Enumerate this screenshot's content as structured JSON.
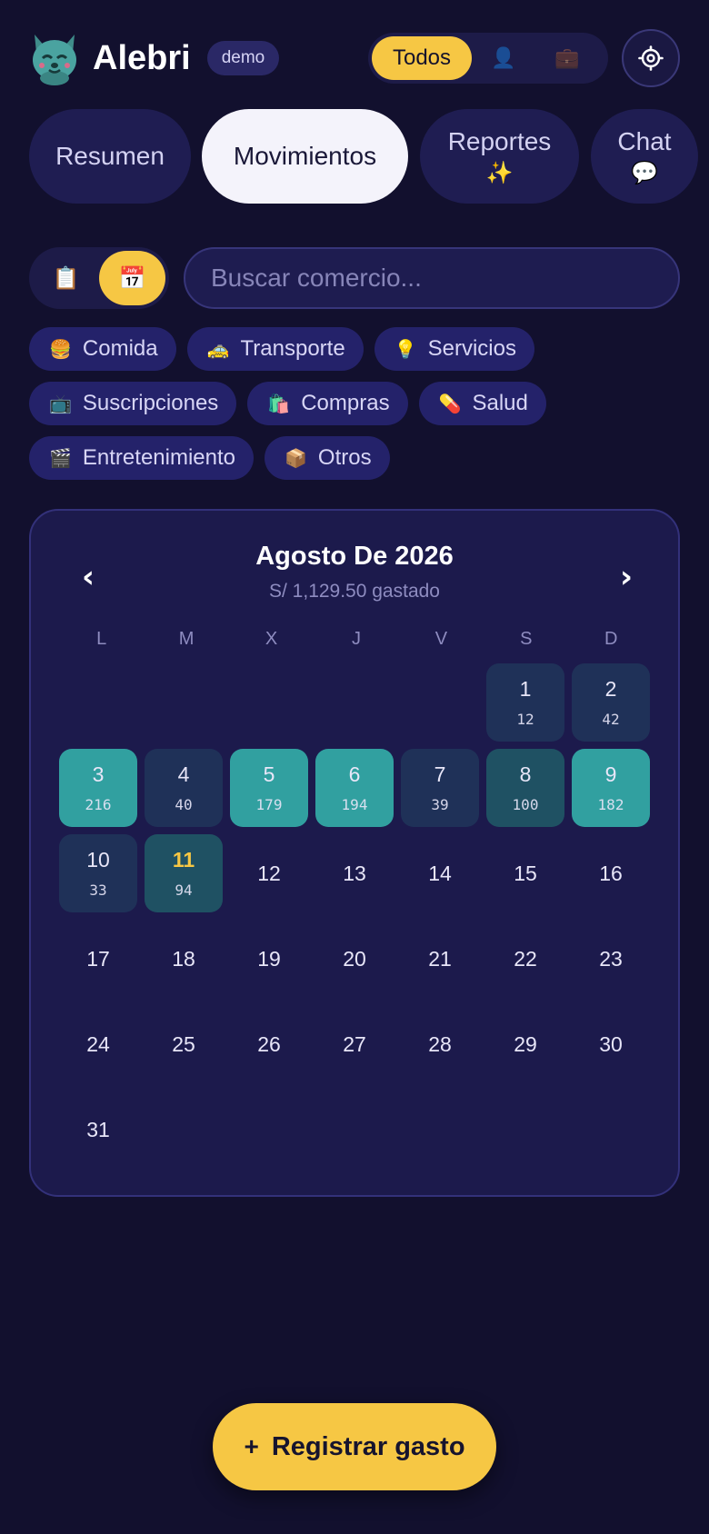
{
  "header": {
    "brand": "Alebri",
    "badge": "demo",
    "scope": [
      {
        "label": "Todos",
        "active": true
      },
      {
        "icon": "person-icon",
        "glyph": "👤",
        "active": false
      },
      {
        "icon": "briefcase-icon",
        "glyph": "💼",
        "active": false
      }
    ],
    "settings_icon": "gear-icon"
  },
  "tabs": [
    {
      "label": "Resumen",
      "emoji": "",
      "active": false
    },
    {
      "label": "Movimientos",
      "emoji": "",
      "active": true
    },
    {
      "label": "Reportes",
      "emoji": "✨",
      "active": false
    },
    {
      "label": "Chat",
      "emoji": "💬",
      "active": false
    }
  ],
  "view_toggle": [
    {
      "icon": "clipboard-icon",
      "glyph": "📋",
      "active": false
    },
    {
      "icon": "calendar-icon",
      "glyph": "📅",
      "active": true
    }
  ],
  "search": {
    "placeholder": "Buscar comercio...",
    "value": ""
  },
  "categories": [
    [
      {
        "emoji": "🍔",
        "label": "Comida"
      },
      {
        "emoji": "🚕",
        "label": "Transporte"
      },
      {
        "emoji": "💡",
        "label": "Servicios"
      }
    ],
    [
      {
        "emoji": "📺",
        "label": "Suscripciones"
      },
      {
        "emoji": "🛍️",
        "label": "Compras"
      },
      {
        "emoji": "💊",
        "label": "Salud"
      }
    ],
    [
      {
        "emoji": "🎬",
        "label": "Entretenimiento"
      },
      {
        "emoji": "📦",
        "label": "Otros"
      }
    ]
  ],
  "calendar": {
    "title": "Agosto De 2026",
    "subtitle": "S/ 1,129.50 gastado",
    "prev": "‹",
    "next": "›",
    "weekdays": [
      "L",
      "M",
      "X",
      "J",
      "V",
      "S",
      "D"
    ],
    "first_weekday_index": 5,
    "days_in_month": 31,
    "today": 11,
    "spending": {
      "1": 12,
      "2": 42,
      "3": 216,
      "4": 40,
      "5": 179,
      "6": 194,
      "7": 39,
      "8": 100,
      "9": 182,
      "10": 33,
      "11": 94
    },
    "colors": {
      "low": "#1f3158",
      "mid": "#1f5163",
      "high": "#31a0a0"
    }
  },
  "fab": {
    "plus": "+",
    "label": "Registrar gasto"
  }
}
